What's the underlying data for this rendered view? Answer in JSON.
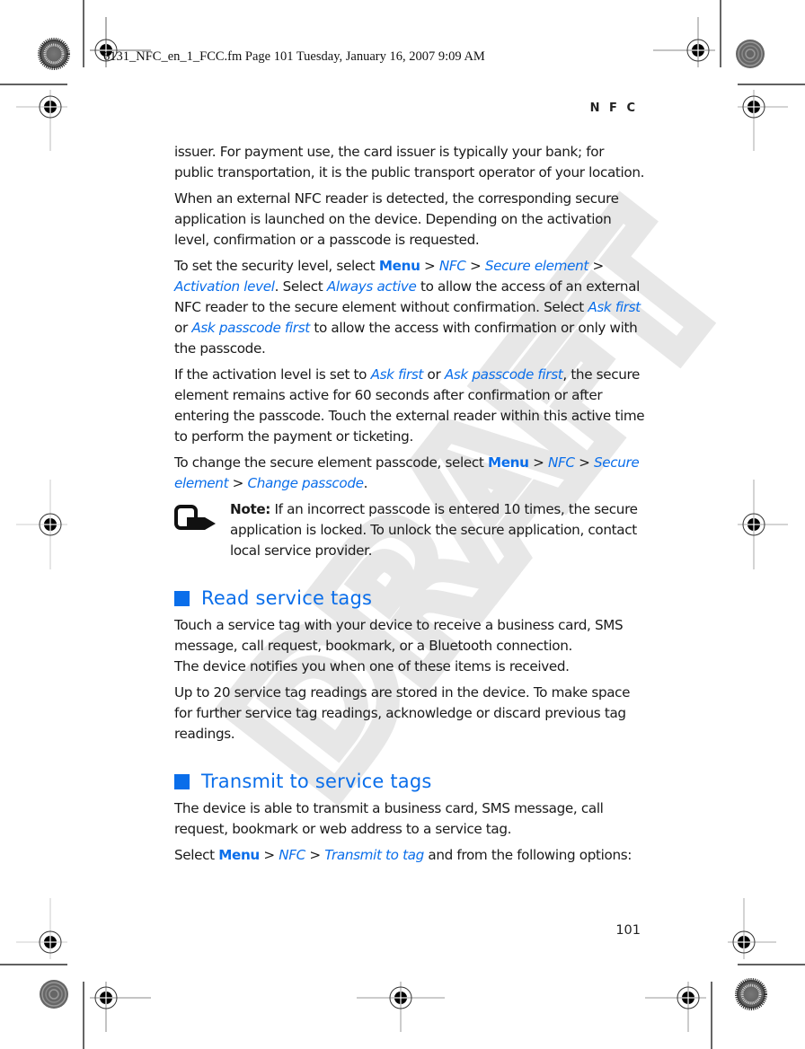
{
  "slug_line": "6131_NFC_en_1_FCC.fm  Page 101  Tuesday, January 16, 2007  9:09 AM",
  "running_head": "N F C",
  "watermark": "DRAFT",
  "page_number": "101",
  "colors": {
    "accent": "#0a6eea",
    "text": "#1a1a1a",
    "watermark": "#e3e3e3"
  },
  "paragraphs": {
    "p1": "issuer. For payment use, the card issuer is typically your bank; for public transportation, it is the public transport operator of your location.",
    "p2": "When an external NFC reader is detected, the corresponding secure application is launched on the device. Depending on the activation level, confirmation or a passcode is requested.",
    "p3": {
      "t1": "To set the security level, select ",
      "menu": "Menu",
      "sep1": " > ",
      "nfc": "NFC",
      "sep2": " > ",
      "secure_element": "Secure element",
      "sep3": " > ",
      "activation_level": "Activation level",
      "t2": ". Select ",
      "always_active": "Always active",
      "t3": " to allow the access of an external NFC reader to the secure element without confirmation. Select ",
      "ask_first": "Ask first",
      "t4": " or ",
      "ask_passcode_first": "Ask passcode first",
      "t5": " to allow the access with confirmation or only with the passcode."
    },
    "p4": {
      "t1": "If the activation level is set to ",
      "ask_first": "Ask first",
      "t2": " or ",
      "ask_passcode_first": "Ask passcode first",
      "t3": ", the secure element remains active for 60 seconds after confirmation or after entering the passcode. Touch the external reader within this active time to perform the payment or ticketing."
    },
    "p5": {
      "t1": "To change the secure element passcode, select ",
      "menu": "Menu",
      "sep1": " > ",
      "nfc": "NFC",
      "sep2": " > ",
      "secure_element": "Secure element",
      "sep3": " > ",
      "change_passcode": "Change passcode",
      "t2": "."
    },
    "note": {
      "label": "Note:",
      "text": " If an incorrect passcode is entered 10 times, the secure application is locked. To unlock the secure application, contact local service provider."
    }
  },
  "sections": [
    {
      "heading": "Read service tags",
      "p1a": "Touch a service tag with your device to receive a business card, SMS message, call request, bookmark, or a Bluetooth connection.",
      "p1b": "The device notifies you when one of these items is received.",
      "p2": "Up to 20 service tag readings are stored in the device. To make space for further service tag readings, acknowledge or discard previous tag readings."
    },
    {
      "heading": "Transmit to service tags",
      "p1": "The device is able to transmit a business card, SMS message, call request, bookmark or web address to a service tag.",
      "p2": {
        "t1": "Select ",
        "menu": "Menu",
        "sep1": " > ",
        "nfc": "NFC",
        "sep2": " > ",
        "transmit_to_tag": "Transmit to tag",
        "t2": " and from the following options:"
      }
    }
  ]
}
